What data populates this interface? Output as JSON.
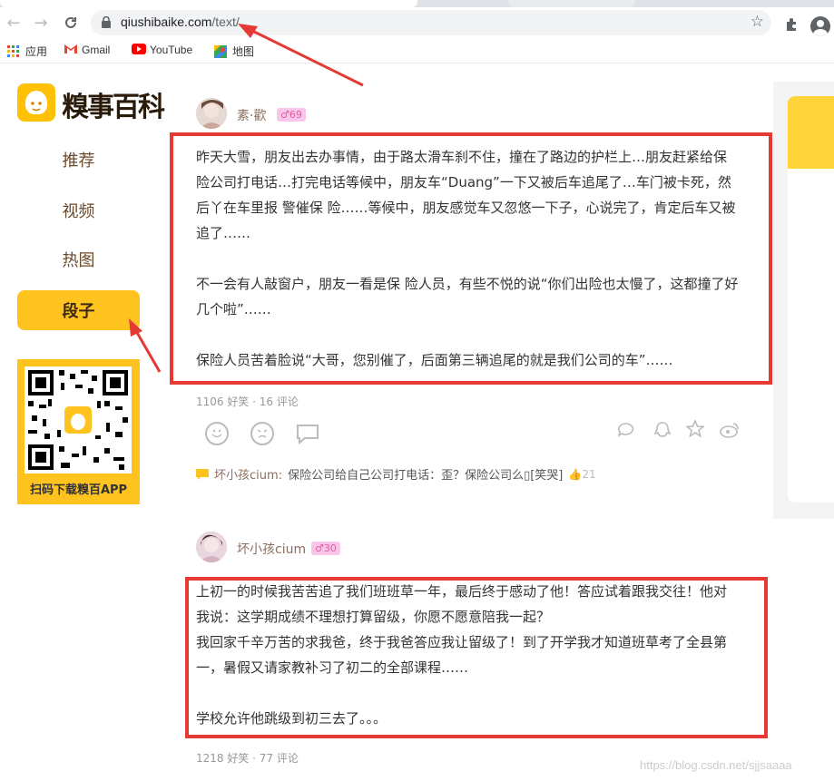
{
  "browser": {
    "url_domain": "qiushibaike.com",
    "url_path": "/text/",
    "bookmarks": [
      {
        "label": "应用",
        "icon": "apps-grid-icon"
      },
      {
        "label": "Gmail",
        "icon": "gmail-icon"
      },
      {
        "label": "YouTube",
        "icon": "youtube-icon"
      },
      {
        "label": "地图",
        "icon": "maps-icon"
      }
    ]
  },
  "site": {
    "logo_text": "糗事百科",
    "nav": [
      {
        "label": "推荐",
        "active": false
      },
      {
        "label": "视频",
        "active": false
      },
      {
        "label": "热图",
        "active": false
      },
      {
        "label": "段子",
        "active": true
      }
    ],
    "qr_label": "扫码下载糗百APP"
  },
  "posts": [
    {
      "author": "素·歡",
      "level": "69",
      "paragraphs": [
        "昨天大雪，朋友出去办事情，由于路太滑车刹不住，撞在了路边的护栏上…朋友赶紧给保 险公司打电话…打完电话等候中，朋友车“Duang”一下又被后车追尾了…车门被卡死，然后丫在车里报 警催保 险……等候中，朋友感觉车又忽悠一下子，心说完了，肯定后车又被追了……",
        "不一会有人敲窗户，朋友一看是保 险人员，有些不悦的说“你们出险也太慢了，这都撞了好几个啦”……",
        "保险人员苦着脸说“大哥，您别催了，后面第三辆追尾的就是我们公司的车”……"
      ],
      "stats": "1106 好笑 · 16 评论",
      "top_comment": {
        "user": "坏小孩cium",
        "text": "保险公司给自己公司打电话：歪？保险公司么▯[笑哭]",
        "likes": "21"
      }
    },
    {
      "author": "坏小孩cium",
      "level": "30",
      "paragraphs": [
        "上初一的时候我苦苦追了我们班班草一年，最后终于感动了他！答应试着跟我交往！他对我说：这学期成绩不理想打算留级，你愿不愿意陪我一起？",
        "我回家千辛万苦的求我爸，终于我爸答应我让留级了！到了开学我才知道班草考了全县第一，暑假又请家教补习了初二的全部课程……",
        "学校允许他跳级到初三去了。。。"
      ],
      "stats": "1218 好笑 · 77 评论"
    }
  ],
  "watermark": "https://blog.csdn.net/sjjsaaaa"
}
